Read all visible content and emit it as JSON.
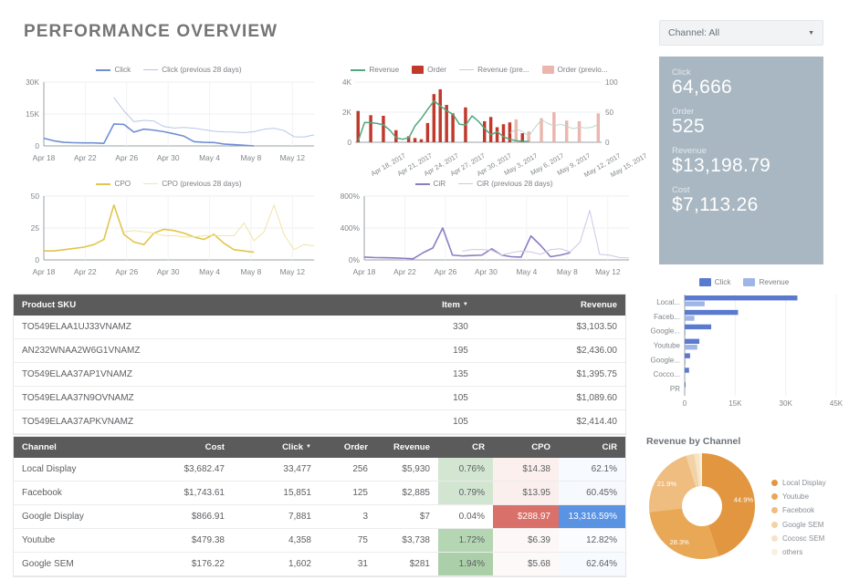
{
  "header": {
    "title": "PERFORMANCE OVERVIEW",
    "filter_label": "Channel: All",
    "caret_icon": "chevron-down-icon"
  },
  "kpi": {
    "items": [
      {
        "label": "Click",
        "value": "64,666"
      },
      {
        "label": "Order",
        "value": "525"
      },
      {
        "label": "Revenue",
        "value": "$13,198.79"
      },
      {
        "label": "Cost",
        "value": "$7,113.26"
      }
    ],
    "bg_color": "#a9b7c2"
  },
  "chart_data": [
    {
      "id": "click_chart",
      "type": "line",
      "title": "",
      "legend": [
        {
          "name": "Click",
          "color": "#6f8fd4",
          "style": "solid-bold"
        },
        {
          "name": "Click (previous 28 days)",
          "color": "#b7c7ea",
          "style": "solid-thin"
        }
      ],
      "xlabel": "",
      "ylabel": "",
      "ylim": [
        0,
        30000
      ],
      "yticks": [
        "0",
        "15K",
        "30K"
      ],
      "xticks": [
        "Apr 18",
        "Apr 22",
        "Apr 26",
        "Apr 30",
        "May 4",
        "May 8",
        "May 12"
      ],
      "x": [
        0,
        1,
        2,
        3,
        4,
        5,
        6,
        7,
        8,
        9,
        10,
        11,
        12,
        13,
        14,
        15,
        16,
        17,
        18,
        19,
        20,
        21,
        22,
        23,
        24,
        25,
        26,
        27
      ],
      "series": [
        {
          "name": "Click",
          "values": [
            3600,
            2400,
            1700,
            1500,
            1400,
            1400,
            1200,
            10300,
            10100,
            6500,
            7900,
            7400,
            6700,
            5700,
            4600,
            2000,
            1700,
            1600,
            900,
            600,
            300,
            0,
            null,
            null,
            null,
            null,
            null,
            null
          ]
        },
        {
          "name": "Click (previous 28 days)",
          "values": [
            null,
            null,
            null,
            null,
            null,
            null,
            null,
            22700,
            16500,
            11400,
            12000,
            11700,
            9100,
            8400,
            8700,
            8300,
            7600,
            6900,
            6600,
            6500,
            6200,
            6700,
            7800,
            8300,
            7200,
            4300,
            4200,
            5200
          ]
        }
      ],
      "grid": true
    },
    {
      "id": "revenue_order_chart",
      "type": "combo",
      "legend": [
        {
          "name": "Revenue",
          "color": "#4fa87d",
          "style": "solid-bold"
        },
        {
          "name": "Order",
          "color": "#c0392b",
          "style": "bar"
        },
        {
          "name": "Revenue (pre...",
          "color": "#bcd7c8",
          "style": "solid-thin"
        },
        {
          "name": "Order (previo...",
          "color": "#eab6ae",
          "style": "bar"
        }
      ],
      "ylim_left": [
        0,
        4000
      ],
      "yticks_left": [
        "0",
        "2K",
        "4K"
      ],
      "ylim_right": [
        0,
        100
      ],
      "yticks_right": [
        "0",
        "50",
        "100"
      ],
      "xticks": [
        "Apr 18, 2017",
        "Apr 21, 2017",
        "Apr 24, 2017",
        "Apr 27, 2017",
        "Apr 30, 2017",
        "May 3, 2017",
        "May 6, 2017",
        "May 9, 2017",
        "May 12, 2017",
        "May 15, 2017"
      ],
      "series": [
        {
          "name": "Order",
          "kind": "bar",
          "values": [
            52,
            0,
            45,
            0,
            44,
            0,
            20,
            0,
            10,
            7,
            5,
            32,
            80,
            88,
            62,
            48,
            0,
            58,
            0,
            0,
            35,
            42,
            25,
            30,
            33,
            0,
            15,
            0,
            0,
            0,
            0,
            0,
            0,
            0,
            0,
            0,
            0,
            0,
            0
          ]
        },
        {
          "name": "Order (previous 28 days)",
          "kind": "bar",
          "values": [
            0,
            0,
            0,
            0,
            0,
            0,
            0,
            0,
            0,
            0,
            0,
            0,
            0,
            0,
            0,
            0,
            0,
            0,
            0,
            0,
            0,
            0,
            0,
            0,
            0,
            38,
            0,
            18,
            0,
            40,
            0,
            50,
            0,
            36,
            0,
            35,
            0,
            0,
            48
          ]
        },
        {
          "name": "Revenue",
          "kind": "line",
          "values": [
            100,
            1320,
            1300,
            1250,
            1150,
            800,
            300,
            200,
            300,
            1100,
            1600,
            2200,
            2750,
            2400,
            2100,
            1850,
            1200,
            1150,
            1750,
            1400,
            900,
            500,
            700,
            350,
            200,
            100,
            60,
            50,
            null,
            null,
            null,
            null,
            null,
            null,
            null,
            null,
            null,
            null,
            null
          ]
        },
        {
          "name": "Revenue (previous 28 days)",
          "kind": "line",
          "values": [
            null,
            null,
            null,
            null,
            null,
            null,
            null,
            null,
            null,
            null,
            null,
            null,
            null,
            null,
            null,
            null,
            null,
            null,
            null,
            null,
            null,
            null,
            null,
            null,
            600,
            900,
            700,
            400,
            1000,
            1500,
            1250,
            1100,
            1200,
            1050,
            900,
            1000,
            950,
            1000,
            1200
          ]
        }
      ],
      "grid": true
    },
    {
      "id": "cpo_chart",
      "type": "line",
      "legend": [
        {
          "name": "CPO",
          "color": "#e0c64a",
          "style": "solid-bold"
        },
        {
          "name": "CPO (previous 28 days)",
          "color": "#f0e4a8",
          "style": "solid-thin"
        }
      ],
      "ylim": [
        0,
        50
      ],
      "yticks": [
        "0",
        "25",
        "50"
      ],
      "xticks": [
        "Apr 18",
        "Apr 22",
        "Apr 26",
        "Apr 30",
        "May 4",
        "May 8",
        "May 12"
      ],
      "series": [
        {
          "name": "CPO",
          "values": [
            7,
            7,
            8,
            9,
            10,
            12,
            16,
            43,
            20,
            14,
            12,
            21,
            24,
            23,
            21,
            18,
            16,
            20,
            13,
            8,
            7,
            6,
            null,
            null,
            null,
            null,
            null,
            null
          ]
        },
        {
          "name": "CPO (previous 28 days)",
          "values": [
            null,
            null,
            null,
            null,
            null,
            null,
            null,
            null,
            22,
            23,
            22,
            21,
            19,
            19,
            18,
            18,
            19,
            19,
            19,
            19,
            29,
            15,
            22,
            43,
            20,
            8,
            12,
            11
          ]
        }
      ],
      "grid": true
    },
    {
      "id": "cir_chart",
      "type": "line",
      "legend": [
        {
          "name": "CiR",
          "color": "#8e7cc3",
          "style": "solid-bold"
        },
        {
          "name": "CiR (previous 28 days)",
          "color": "#cfc6e6",
          "style": "solid-thin"
        }
      ],
      "ylim": [
        0,
        800
      ],
      "yticks": [
        "0%",
        "400%",
        "800%"
      ],
      "xticks": [
        "Apr 18",
        "Apr 22",
        "Apr 26",
        "Apr 30",
        "May 4",
        "May 8",
        "May 12"
      ],
      "series": [
        {
          "name": "CiR",
          "values": [
            35,
            30,
            28,
            25,
            20,
            15,
            90,
            150,
            400,
            60,
            50,
            55,
            60,
            140,
            60,
            40,
            35,
            300,
            180,
            40,
            60,
            90,
            null,
            null,
            null,
            null,
            null,
            null
          ]
        },
        {
          "name": "CiR (previous 28 days)",
          "values": [
            null,
            null,
            null,
            null,
            null,
            null,
            null,
            null,
            null,
            null,
            110,
            130,
            130,
            120,
            60,
            90,
            110,
            100,
            70,
            130,
            140,
            100,
            220,
            620,
            70,
            60,
            30,
            25
          ]
        }
      ],
      "grid": true
    },
    {
      "id": "click_revenue_bar",
      "type": "bar",
      "orientation": "horizontal",
      "legend": [
        {
          "name": "Click",
          "color": "#5a7ad0"
        },
        {
          "name": "Revenue",
          "color": "#9fb5e8"
        }
      ],
      "categories": [
        "Local...",
        "Faceb...",
        "Google...",
        "Youtube",
        "Google...",
        "Cocco...",
        "PR"
      ],
      "xticks": [
        "0",
        "15K",
        "30K",
        "45K"
      ],
      "xlim": [
        0,
        45000
      ],
      "series": [
        {
          "name": "Click",
          "values": [
            33477,
            15851,
            7881,
            4358,
            1602,
            1300,
            120
          ]
        },
        {
          "name": "Revenue",
          "values": [
            5930,
            2885,
            7,
            3738,
            281,
            0,
            0
          ]
        }
      ]
    },
    {
      "id": "revenue_by_channel_donut",
      "type": "pie",
      "title": "Revenue by Channel",
      "labels": [
        "Local Display",
        "Youtube",
        "Facebook",
        "Google SEM",
        "Cocosc SEM",
        "others"
      ],
      "values": [
        44.9,
        28.3,
        21.9,
        2.6,
        1.5,
        0.8
      ],
      "visible_labels": [
        "44.9%",
        "28.3%",
        "21.9%"
      ],
      "colors": [
        "#e2963f",
        "#e8a856",
        "#eebd7f",
        "#f3d2a6",
        "#f7e3c6",
        "#faf0dd"
      ],
      "legend_position": "right"
    }
  ],
  "sku_table": {
    "columns": [
      "Product SKU",
      "Item",
      "Revenue"
    ],
    "sorted_column": "Item",
    "sort_icon": "caret-down-icon",
    "rows": [
      {
        "sku": "TO549ELAA1UJ33VNAMZ",
        "item": "330",
        "revenue": "$3,103.50"
      },
      {
        "sku": "AN232WNAA2W6G1VNAMZ",
        "item": "195",
        "revenue": "$2,436.00"
      },
      {
        "sku": "TO549ELAA37AP1VNAMZ",
        "item": "135",
        "revenue": "$1,395.75"
      },
      {
        "sku": "TO549ELAA37N9OVNAMZ",
        "item": "105",
        "revenue": "$1,089.60"
      },
      {
        "sku": "TO549ELAA37APKVNAMZ",
        "item": "105",
        "revenue": "$2,414.40"
      }
    ]
  },
  "channel_table": {
    "columns": [
      "Channel",
      "Cost",
      "Click",
      "Order",
      "Revenue",
      "CR",
      "CPO",
      "CiR"
    ],
    "sorted_column": "Click",
    "sort_icon": "caret-down-icon",
    "rows": [
      {
        "channel": "Local Display",
        "cost": "$3,682.47",
        "click": "33,477",
        "order": "256",
        "revenue": "$5,930",
        "cr": "0.76%",
        "cpo": "$14.38",
        "cir": "62.1%",
        "cr_bg": "#d3e6d2",
        "cpo_bg": "#fbf0ee",
        "cir_bg": "#f7fafe"
      },
      {
        "channel": "Facebook",
        "cost": "$1,743.61",
        "click": "15,851",
        "order": "125",
        "revenue": "$2,885",
        "cr": "0.79%",
        "cpo": "$13.95",
        "cir": "60.45%",
        "cr_bg": "#d2e5d1",
        "cpo_bg": "#fbefed",
        "cir_bg": "#f6f9fe"
      },
      {
        "channel": "Google Display",
        "cost": "$866.91",
        "click": "7,881",
        "order": "3",
        "revenue": "$7",
        "cr": "0.04%",
        "cpo": "$288.97",
        "cir": "13,316.59%",
        "cr_bg": "#ffffff",
        "cpo_bg": "#d9706a",
        "cir_bg": "#5b93e3",
        "cpo_fg": "#ffffff",
        "cir_fg": "#ffffff"
      },
      {
        "channel": "Youtube",
        "cost": "$479.38",
        "click": "4,358",
        "order": "75",
        "revenue": "$3,738",
        "cr": "1.72%",
        "cpo": "$6.39",
        "cir": "12.82%",
        "cr_bg": "#b5d6b3",
        "cpo_bg": "#fdf8f7",
        "cir_bg": "#fbfcfe"
      },
      {
        "channel": "Google SEM",
        "cost": "$176.22",
        "click": "1,602",
        "order": "31",
        "revenue": "$281",
        "cr": "1.94%",
        "cpo": "$5.68",
        "cir": "62.64%",
        "cr_bg": "#abd0a9",
        "cpo_bg": "#fdf9f8",
        "cir_bg": "#f7fafe"
      }
    ]
  }
}
